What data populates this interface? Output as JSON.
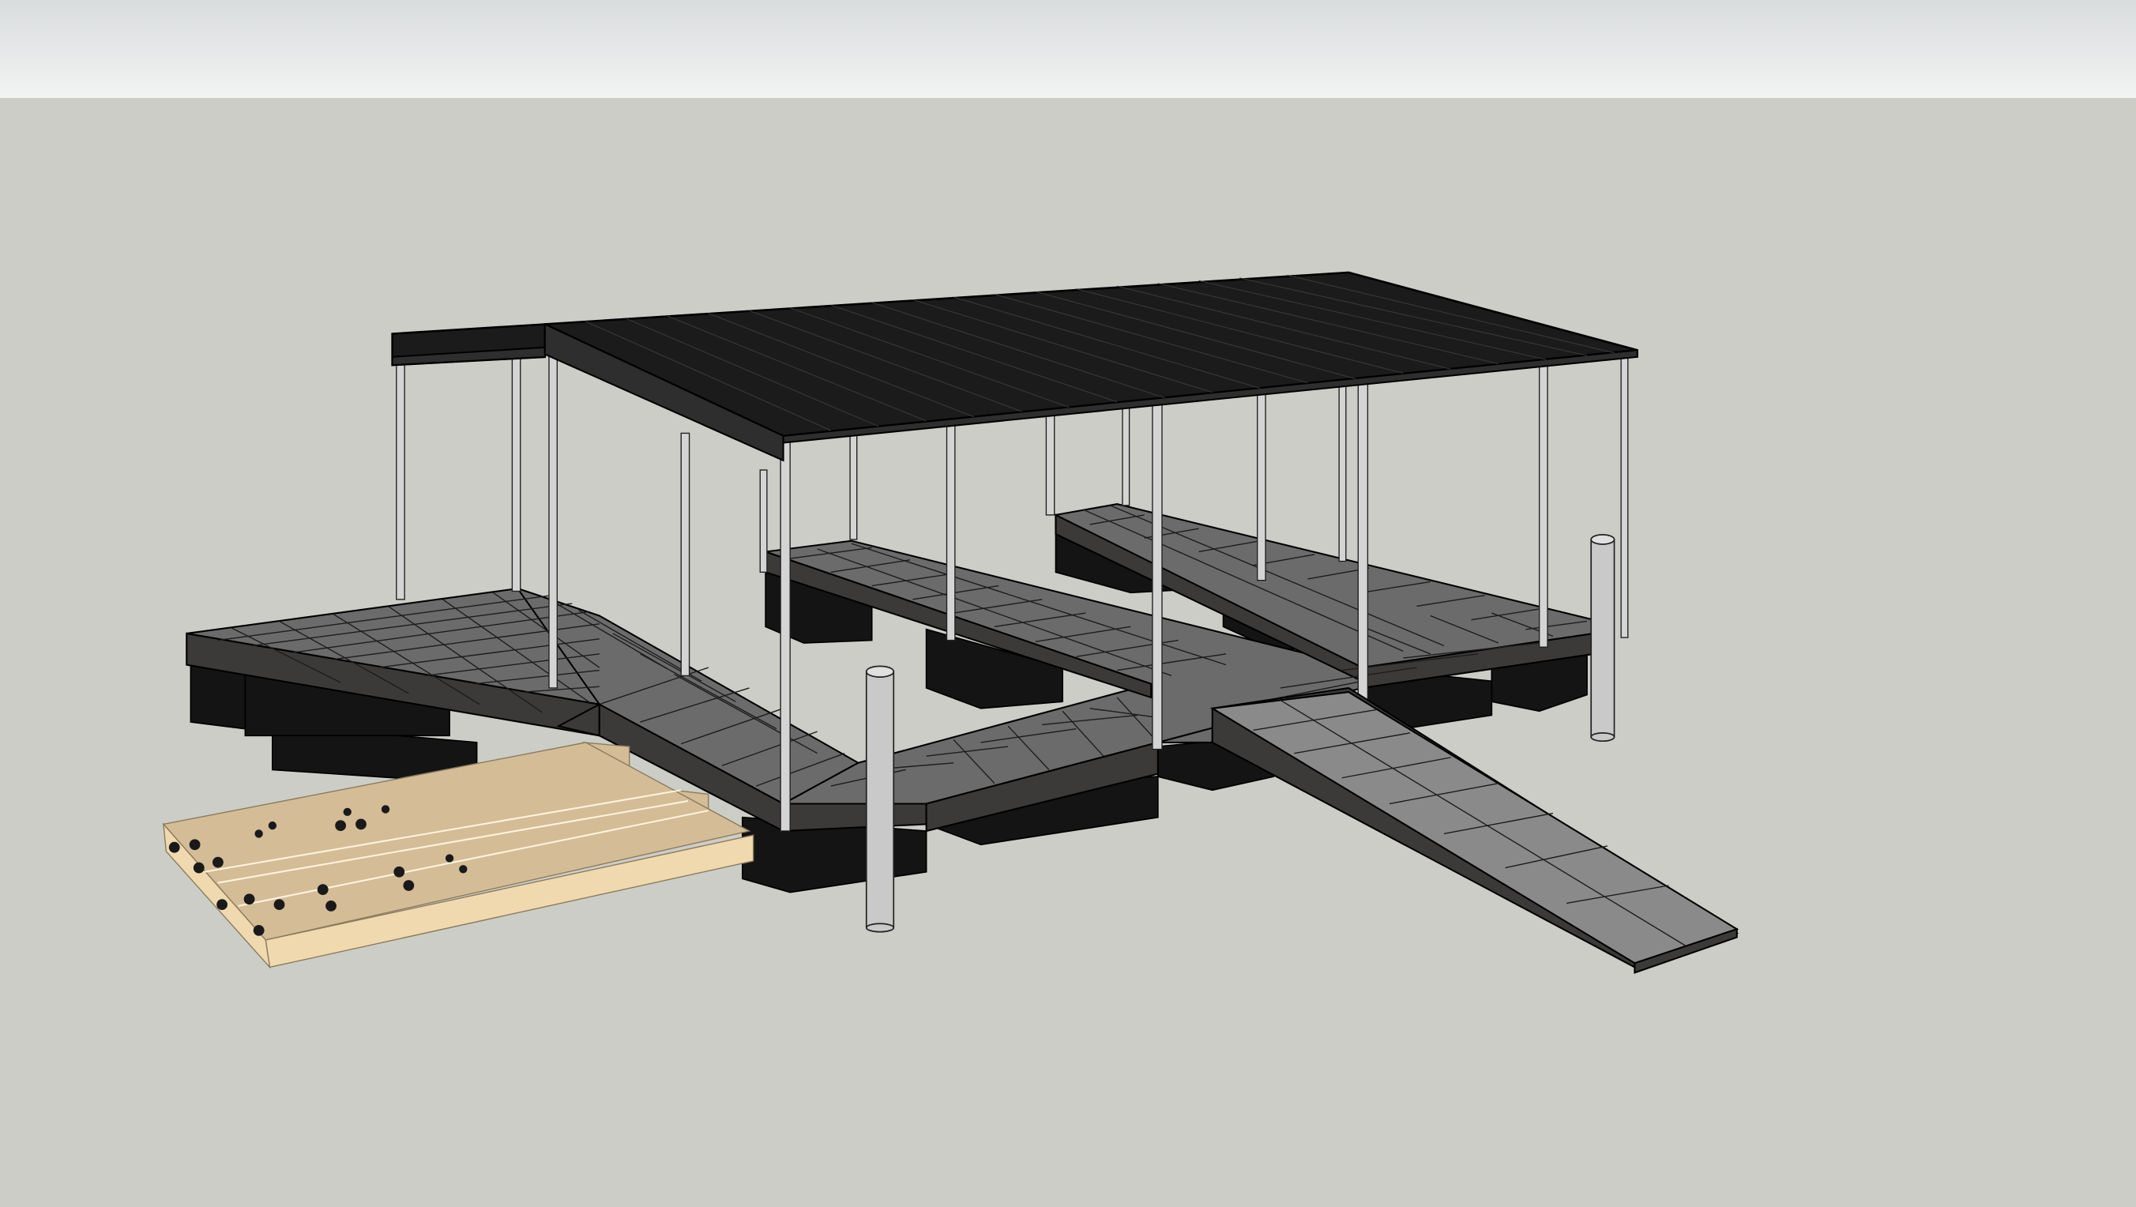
{
  "scene": {
    "sky_top_color": "#d9dcdd",
    "sky_bottom_color": "#f2f3f3",
    "ground_color": "#cccdc6",
    "horizon_line_color": "#e6e7e5"
  },
  "model": {
    "roof_color": "#1b1b1b",
    "roof_edge_color": "#2e2e2e",
    "deck_top_color": "#6b6b6b",
    "deck_grid_color": "#1c1c1c",
    "deck_fascia_color": "#3c3a39",
    "float_color": "#141414",
    "post_color": "#d4d4d4",
    "piling_color": "#c9c9c9",
    "ramp_color": "#8a8a8a",
    "lumber_color": "#f0d9ae",
    "lumber_top_color": "#d4bc97",
    "bolt_color": "#1a1a1a"
  }
}
